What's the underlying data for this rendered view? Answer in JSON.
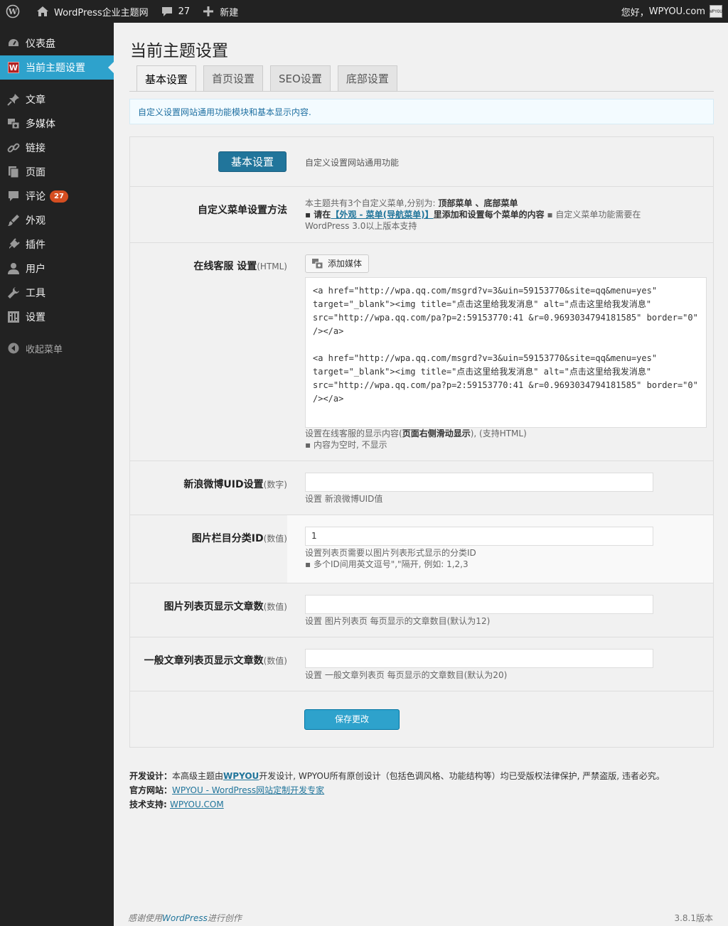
{
  "adminbar": {
    "site_name": "WordPress企业主题网",
    "comments_count": "27",
    "new_label": "新建",
    "greeting": "您好，",
    "user_name": "WPYOU.com",
    "avatar_text": "WPYOU"
  },
  "sidebar": {
    "items": [
      {
        "label": "仪表盘"
      },
      {
        "label": "当前主题设置"
      },
      {
        "label": "文章"
      },
      {
        "label": "多媒体"
      },
      {
        "label": "链接"
      },
      {
        "label": "页面"
      },
      {
        "label": "评论",
        "badge": "27"
      },
      {
        "label": "外观"
      },
      {
        "label": "插件"
      },
      {
        "label": "用户"
      },
      {
        "label": "工具"
      },
      {
        "label": "设置"
      }
    ],
    "collapse_label": "收起菜单",
    "theme_logo_letter": "W"
  },
  "page": {
    "title": "当前主题设置",
    "tabs": [
      "基本设置",
      "首页设置",
      "SEO设置",
      "底部设置"
    ],
    "notice": "自定义设置网站通用功能模块和基本显示内容."
  },
  "form": {
    "section_button": "基本设置",
    "section_desc": "自定义设置网站通用功能",
    "menu_row": {
      "label": "自定义菜单设置方法",
      "line1_prefix": "本主题共有3个自定义菜单,分别为: ",
      "line1_bold": "顶部菜单 、底部菜单",
      "line2_bold_a": "▪ 请在",
      "line2_link": "【外观 - 菜单(导航菜单)】",
      "line2_bold_b": "里添加和设置每个菜单的内容",
      "line2_rest": " ▪ 自定义菜单功能需要在",
      "line3": "WordPress 3.0以上版本支持"
    },
    "service_row": {
      "label": "在线客服 设置",
      "label_hint": "(HTML)",
      "media_button": "添加媒体",
      "code": "<a href=\"http://wpa.qq.com/msgrd?v=3&uin=59153770&site=qq&menu=yes\"\ntarget=\"_blank\"><img title=\"点击这里给我发消息\" alt=\"点击这里给我发消息\"\nsrc=\"http://wpa.qq.com/pa?p=2:59153770:41 &r=0.9693034794181585\" border=\"0\"\n/></a>\n\n<a href=\"http://wpa.qq.com/msgrd?v=3&uin=59153770&site=qq&menu=yes\"\ntarget=\"_blank\"><img title=\"点击这里给我发消息\" alt=\"点击这里给我发消息\"\nsrc=\"http://wpa.qq.com/pa?p=2:59153770:41 &r=0.9693034794181585\" border=\"0\"\n/></a>",
      "desc_prefix": "设置在线客服的显示内容(",
      "desc_bold": "页面右侧滑动显示",
      "desc_suffix": "), (支持HTML)",
      "desc2": "▪ 内容为空时, 不显示"
    },
    "weibo_row": {
      "label": "新浪微博UID设置",
      "label_hint": "(数字)",
      "value": "",
      "desc": "设置 新浪微博UID值"
    },
    "gallery_cat_row": {
      "label": "图片栏目分类ID",
      "label_hint": "(数值)",
      "value": "1",
      "desc": "设置列表页需要以图片列表形式显示的分类ID",
      "desc2": "▪ 多个ID间用英文逗号\",\"隔开, 例如: 1,2,3"
    },
    "gallery_count_row": {
      "label": "图片列表页显示文章数",
      "label_hint": "(数值)",
      "value": "",
      "desc": "设置 图片列表页 每页显示的文章数目(默认为12)"
    },
    "post_count_row": {
      "label": "一般文章列表页显示文章数",
      "label_hint": "(数值)",
      "value": "",
      "desc": "设置 一般文章列表页 每页显示的文章数目(默认为20)"
    },
    "save_button": "保存更改"
  },
  "footer": {
    "dev_label": "开发设计：",
    "dev_text_a": "本高级主题由",
    "dev_link": "WPYOU",
    "dev_text_b": "开发设计, WPYOU所有原创设计（包括色调风格、功能结构等）均已受版权法律保护, 严禁盗版, 违者必究。",
    "site_label": "官方网站：",
    "site_link": "WPYOU - WordPress网站定制开发专家",
    "support_label": "技术支持: ",
    "support_link": "WPYOU.COM",
    "thanks_a": "感谢使用",
    "thanks_link": "WordPress",
    "thanks_b": "进行创作",
    "version": "3.8.1版本"
  },
  "colors": {
    "accent": "#2ea2cc",
    "sidebar_bg": "#222222",
    "badge": "#d54e21",
    "section_button": "#21759b"
  }
}
